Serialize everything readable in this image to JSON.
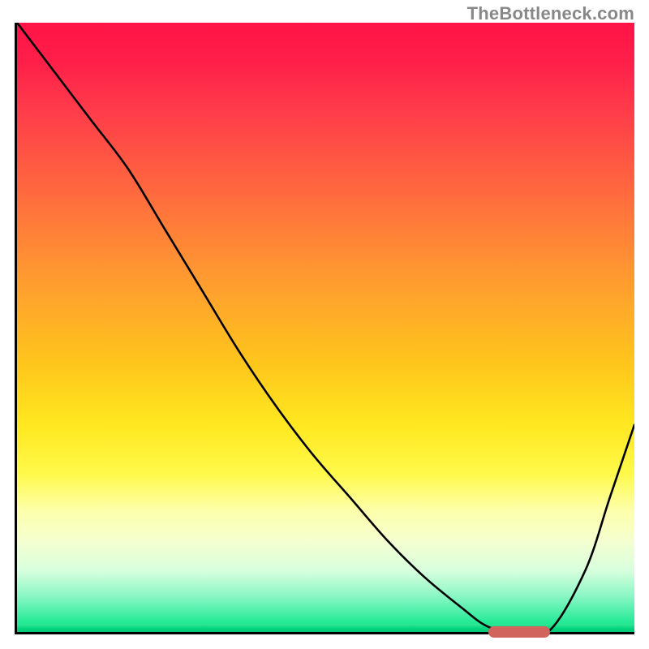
{
  "watermark": "TheBottleneck.com",
  "chart_data": {
    "type": "line",
    "title": "",
    "xlabel": "",
    "ylabel": "",
    "xlim": [
      0,
      100
    ],
    "ylim": [
      0,
      100
    ],
    "grid": false,
    "legend": false,
    "series": [
      {
        "name": "bottleneck-curve",
        "x": [
          0,
          6,
          12,
          18,
          24,
          30,
          36,
          42,
          48,
          54,
          60,
          66,
          72,
          76,
          80,
          86,
          92,
          96,
          100
        ],
        "y": [
          100,
          92,
          84,
          76,
          66,
          56,
          46,
          37,
          29,
          22,
          15,
          9,
          4,
          1,
          0,
          0,
          10,
          22,
          34
        ]
      }
    ],
    "annotations": [
      {
        "name": "optimal-marker",
        "x_start": 76,
        "x_end": 86,
        "y": 0
      }
    ],
    "background_gradient": [
      "#ff1447",
      "#ff6a3e",
      "#ffc61c",
      "#fff94a",
      "#00e585"
    ]
  }
}
